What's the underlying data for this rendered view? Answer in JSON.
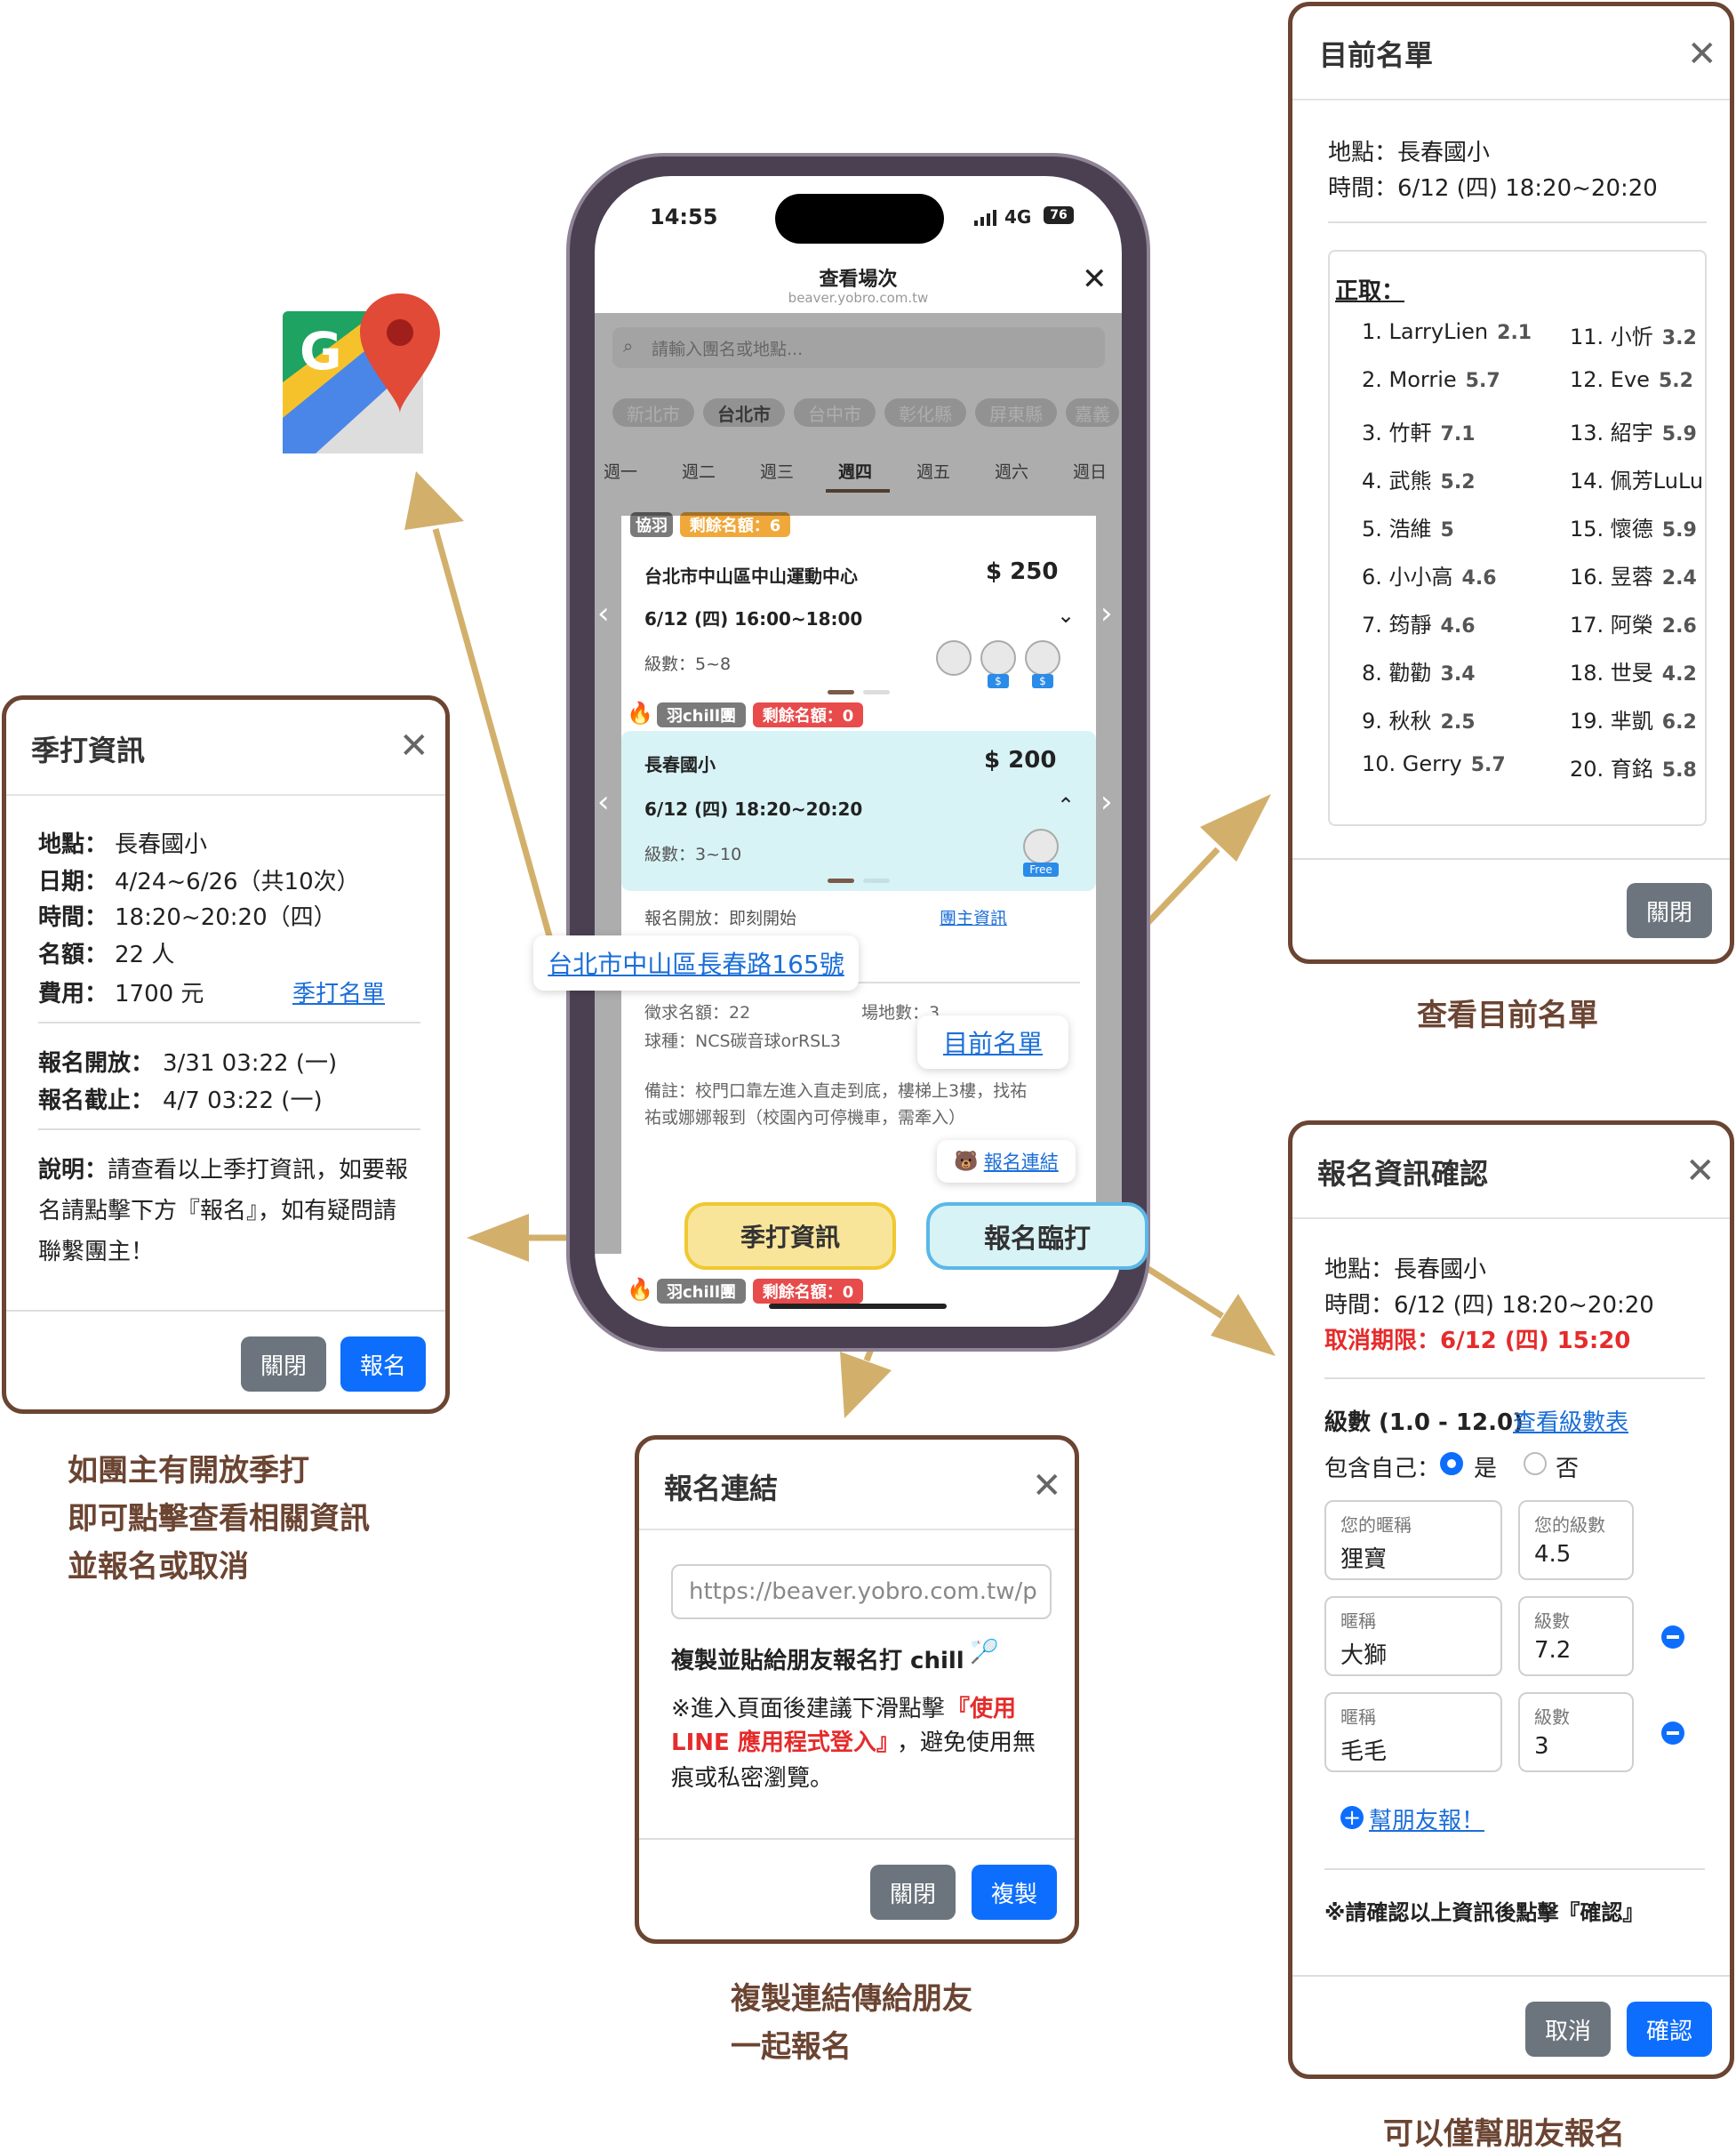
{
  "colors": {
    "brown": "#6b4432",
    "arrow": "#d2b06c",
    "blue": "#0d6efd",
    "red": "#e52b2b",
    "yellow": "#f8e59a",
    "cyan": "#d8f3f6"
  },
  "phone": {
    "time": "14:55",
    "network": "4G",
    "battery": "76",
    "header_title": "查看場次",
    "header_url": "beaver.yobro.com.tw",
    "search_placeholder": "請輸入團名或地點...",
    "cities": [
      "新北市",
      "台北市",
      "台中市",
      "彰化縣",
      "屏東縣",
      "嘉義"
    ],
    "weekdays": [
      "週一",
      "週二",
      "週三",
      "週四",
      "週五",
      "週六",
      "週日"
    ],
    "selected_weekday": "週四",
    "card1": {
      "tag1": "協羽",
      "tag2": "剩餘名額：6",
      "venue": "台北市中山區中山運動中心",
      "price": "$ 250",
      "datetime": "6/12 (四) 16:00~18:00",
      "level": "級數：5~8"
    },
    "card2": {
      "tag1": "羽chill團",
      "tag2": "剩餘名額：0",
      "venue": "長春國小",
      "price": "$ 200",
      "datetime": "6/12 (四) 18:20~20:20",
      "level": "級數：3~10",
      "free_label": "Free"
    },
    "detail": {
      "open_text": "報名開放：即刻開始",
      "host_link": "團主資訊",
      "recruit": "徵求名額：22",
      "courts": "場地數：3",
      "ball": "球種：NCS碳音球orRSL3",
      "note_line1": "備註：校門口靠左進入直走到底，樓梯上3樓，找祐",
      "note_line2": "祐或娜娜報到（校園內可停機車，需牽入）",
      "signup_link": "報名連結"
    },
    "bottom_tags": {
      "tag1": "羽chill團",
      "tag2": "剩餘名額：0"
    },
    "season_button": "季打資訊",
    "signup_button": "報名臨打",
    "address_callout": "台北市中山區長春路165號",
    "list_callout": "目前名單"
  },
  "season_modal": {
    "title": "季打資訊",
    "rows": [
      {
        "label": "地點：",
        "value": "長春國小"
      },
      {
        "label": "日期：",
        "value": "4/24~6/26（共10次）"
      },
      {
        "label": "時間：",
        "value": "18:20~20:20（四）"
      },
      {
        "label": "名額：",
        "value": "22 人"
      },
      {
        "label": "費用：",
        "value": "1700 元"
      }
    ],
    "list_link": "季打名單",
    "open_label": "報名開放：",
    "open_value": "3/31 03:22 (一)",
    "close_label": "報名截止：",
    "close_value": "4/7 03:22 (一)",
    "desc_label": "說明：",
    "desc_line1": "請查看以上季打資訊，如要報",
    "desc_line2": "名請點擊下方『報名』，如有疑問請",
    "desc_line3": "聯繫團主！",
    "close_button": "關閉",
    "signup_button": "報名",
    "caption_lines": [
      "如團主有開放季打",
      "即可點擊查看相關資訊",
      "並報名或取消"
    ]
  },
  "list_modal": {
    "title": "目前名單",
    "place": "地點：長春國小",
    "time": "時間：6/12 (四) 18:20~20:20",
    "heading": "正取：",
    "left": [
      {
        "name": "1.  LarryLien",
        "level": "2.1"
      },
      {
        "name": "2.  Morrie",
        "level": "5.7"
      },
      {
        "name": "3.  竹軒",
        "level": "7.1"
      },
      {
        "name": "4.  武熊",
        "level": "5.2"
      },
      {
        "name": "5.  浩維",
        "level": "5"
      },
      {
        "name": "6.  小小高",
        "level": "4.6"
      },
      {
        "name": "7.  筠靜",
        "level": "4.6"
      },
      {
        "name": "8.  勸勸",
        "level": "3.4"
      },
      {
        "name": "9.  秋秋",
        "level": "2.5"
      },
      {
        "name": "10. Gerry",
        "level": "5.7"
      }
    ],
    "right": [
      {
        "name": "11. 小忻",
        "level": "3.2"
      },
      {
        "name": "12. Eve",
        "level": "5.2"
      },
      {
        "name": "13. 紹宇",
        "level": "5.9"
      },
      {
        "name": "14. 佩芳LuLu",
        "level": ""
      },
      {
        "name": "15. 懷德",
        "level": "5.9"
      },
      {
        "name": "16. 昱蓉",
        "level": "2.4"
      },
      {
        "name": "17. 阿榮",
        "level": "2.6"
      },
      {
        "name": "18. 世旻",
        "level": "4.2"
      },
      {
        "name": "19. 芈凱",
        "level": "6.2"
      },
      {
        "name": "20. 育銘",
        "level": "5.8"
      }
    ],
    "close_button": "關閉",
    "caption": "查看目前名單"
  },
  "link_modal": {
    "title": "報名連結",
    "url_value": "https://beaver.yobro.com.tw/p",
    "copy_line": "複製並貼給朋友報名打 chill",
    "note_prefix": "※進入頁面後建議下滑點擊",
    "note_red1": "『使用",
    "note_red2": "LINE 應用程式登入』",
    "note_suffix1": "，避免使用無",
    "note_suffix2": "痕或私密瀏覽。",
    "close_button": "關閉",
    "copy_button": "複製",
    "caption_lines": [
      "複製連結傳給朋友",
      "一起報名"
    ]
  },
  "confirm_modal": {
    "title": "報名資訊確認",
    "place": "地點：長春國小",
    "time": "時間：6/12 (四) 18:20~20:20",
    "cancel_deadline": "取消期限：6/12 (四) 15:20",
    "level_label": "級數 (1.0 - 12.0)",
    "level_link": "查看級數表",
    "include_self": "包含自己：",
    "yes": "是",
    "no": "否",
    "entries": [
      {
        "name_label": "您的暱稱",
        "name": "狸寶",
        "level_label": "您的級數",
        "level": "4.5",
        "removable": false
      },
      {
        "name_label": "暱稱",
        "name": "大獅",
        "level_label": "級數",
        "level": "7.2",
        "removable": true
      },
      {
        "name_label": "暱稱",
        "name": "毛毛",
        "level_label": "級數",
        "level": "3",
        "removable": true
      }
    ],
    "add_friend": "幫朋友報！",
    "confirm_note": "※請確認以上資訊後點擊『確認』",
    "cancel_button": "取消",
    "confirm_button": "確認",
    "caption": "可以僅幫朋友報名"
  }
}
